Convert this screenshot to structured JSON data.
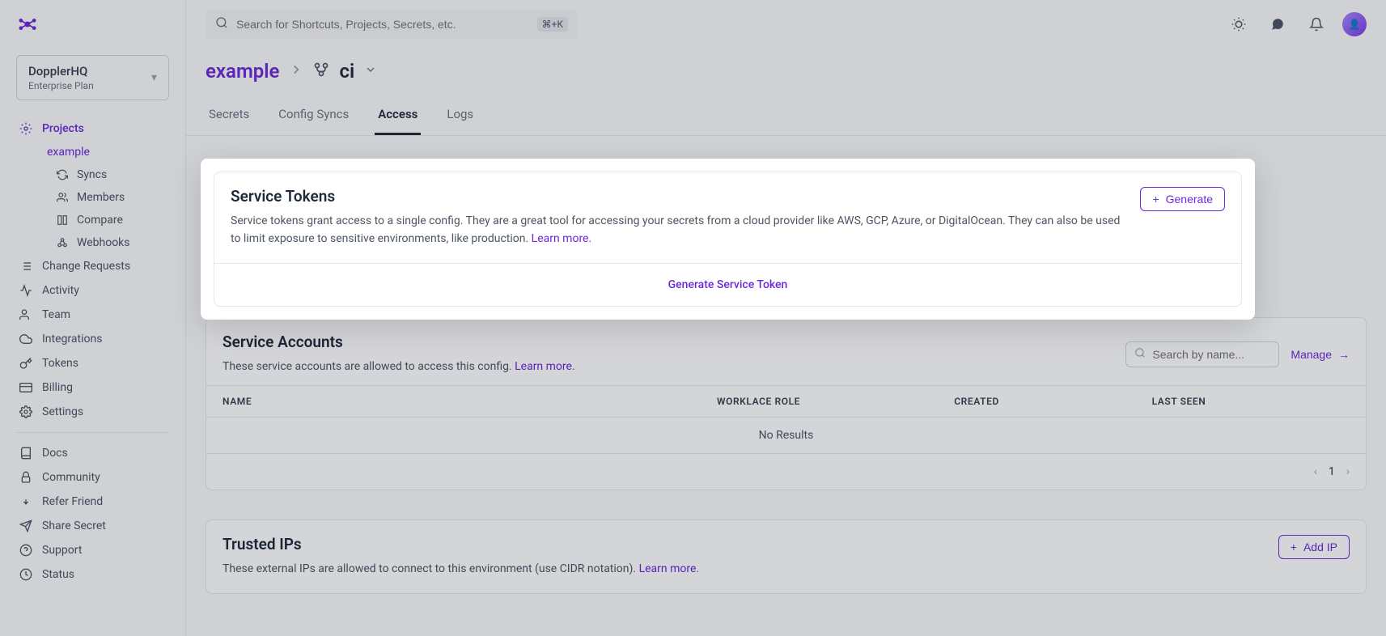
{
  "org": {
    "name": "DopplerHQ",
    "plan": "Enterprise Plan"
  },
  "nav": {
    "projects": "Projects",
    "project_name": "example",
    "syncs": "Syncs",
    "members": "Members",
    "compare": "Compare",
    "webhooks": "Webhooks",
    "change_requests": "Change Requests",
    "activity": "Activity",
    "team": "Team",
    "integrations": "Integrations",
    "tokens": "Tokens",
    "billing": "Billing",
    "settings": "Settings",
    "docs": "Docs",
    "community": "Community",
    "refer": "Refer Friend",
    "share": "Share Secret",
    "support": "Support",
    "status": "Status"
  },
  "search": {
    "placeholder": "Search for Shortcuts, Projects, Secrets, etc.",
    "shortcut": "⌘+K"
  },
  "breadcrumb": {
    "project": "example",
    "config": "ci"
  },
  "tabs": {
    "secrets": "Secrets",
    "config_syncs": "Config Syncs",
    "access": "Access",
    "logs": "Logs"
  },
  "service_tokens": {
    "title": "Service Tokens",
    "desc": "Service tokens grant access to a single config. They are a great tool for accessing your secrets from a cloud provider like AWS, GCP, Azure, or DigitalOcean. They can also be used to limit exposure to sensitive environments, like production.  ",
    "learn_more": "Learn more",
    "generate": "Generate",
    "generate_cta": "Generate Service Token"
  },
  "service_accounts": {
    "title": "Service Accounts",
    "desc": "These service accounts are allowed to access this config.  ",
    "learn_more": "Learn more",
    "search_placeholder": "Search by name...",
    "manage": "Manage",
    "cols": {
      "name": "NAME",
      "role": "WORKLACE ROLE",
      "created": "CREATED",
      "last_seen": "LAST SEEN"
    },
    "empty": "No Results",
    "page": "1"
  },
  "trusted_ips": {
    "title": "Trusted IPs",
    "desc": "These external IPs are allowed to connect to this environment (use CIDR notation).  ",
    "learn_more": "Learn more",
    "add": "Add IP"
  }
}
